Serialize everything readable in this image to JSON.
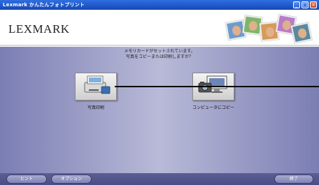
{
  "window": {
    "title": "Lexmark かんたんフォトプリント"
  },
  "header": {
    "logo": "LEXMARK"
  },
  "main": {
    "message_line1": "メモリカードがセットされています。",
    "message_line2": "写真をコピーまたは印刷しますか？"
  },
  "options": [
    {
      "label": "写真印刷",
      "icon": "printer-icon"
    },
    {
      "label": "コンピュータにコピー",
      "icon": "computer-icon"
    }
  ],
  "footer": {
    "hint_label": "ヒント",
    "options_label": "オプション",
    "exit_label": "終了"
  },
  "colors": {
    "titlebar": "#1f57c9",
    "main_bg": "#7b7eb3",
    "footer_bg": "#4a4d83"
  }
}
